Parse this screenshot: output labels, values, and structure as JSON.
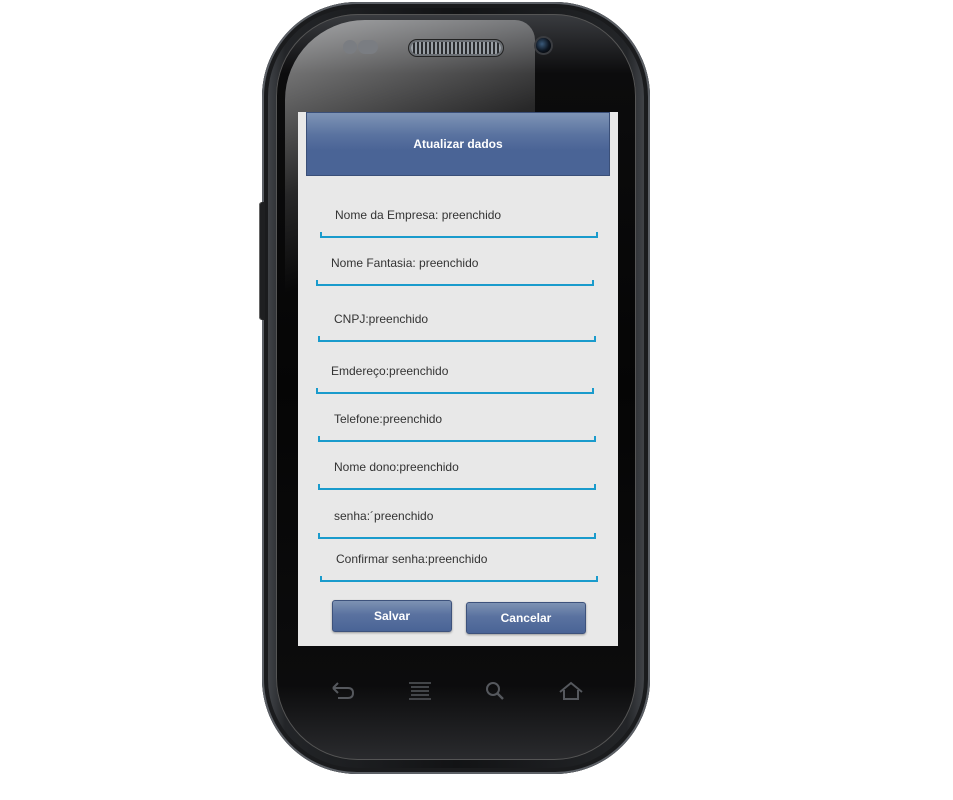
{
  "screen": {
    "title": "Atualizar dados",
    "fields": [
      {
        "label": "Nome da Empresa: preenchido"
      },
      {
        "label": "Nome Fantasia: preenchido"
      },
      {
        "label": "CNPJ:preenchido"
      },
      {
        "label": "Emdereço:preenchido"
      },
      {
        "label": "Telefone:preenchido"
      },
      {
        "label": "Nome dono:preenchido"
      },
      {
        "label": "senha:´preenchido"
      },
      {
        "label": "Confirmar senha:preenchido"
      }
    ],
    "buttons": {
      "save_label": "Salvar",
      "cancel_label": "Cancelar"
    }
  },
  "device": {
    "nav_keys": [
      "back-icon",
      "menu-icon",
      "search-icon",
      "home-icon"
    ]
  },
  "colors": {
    "accent_line": "#1a9bcc",
    "title_bar": "#4a6496",
    "screen_bg": "#e8e8e8"
  }
}
